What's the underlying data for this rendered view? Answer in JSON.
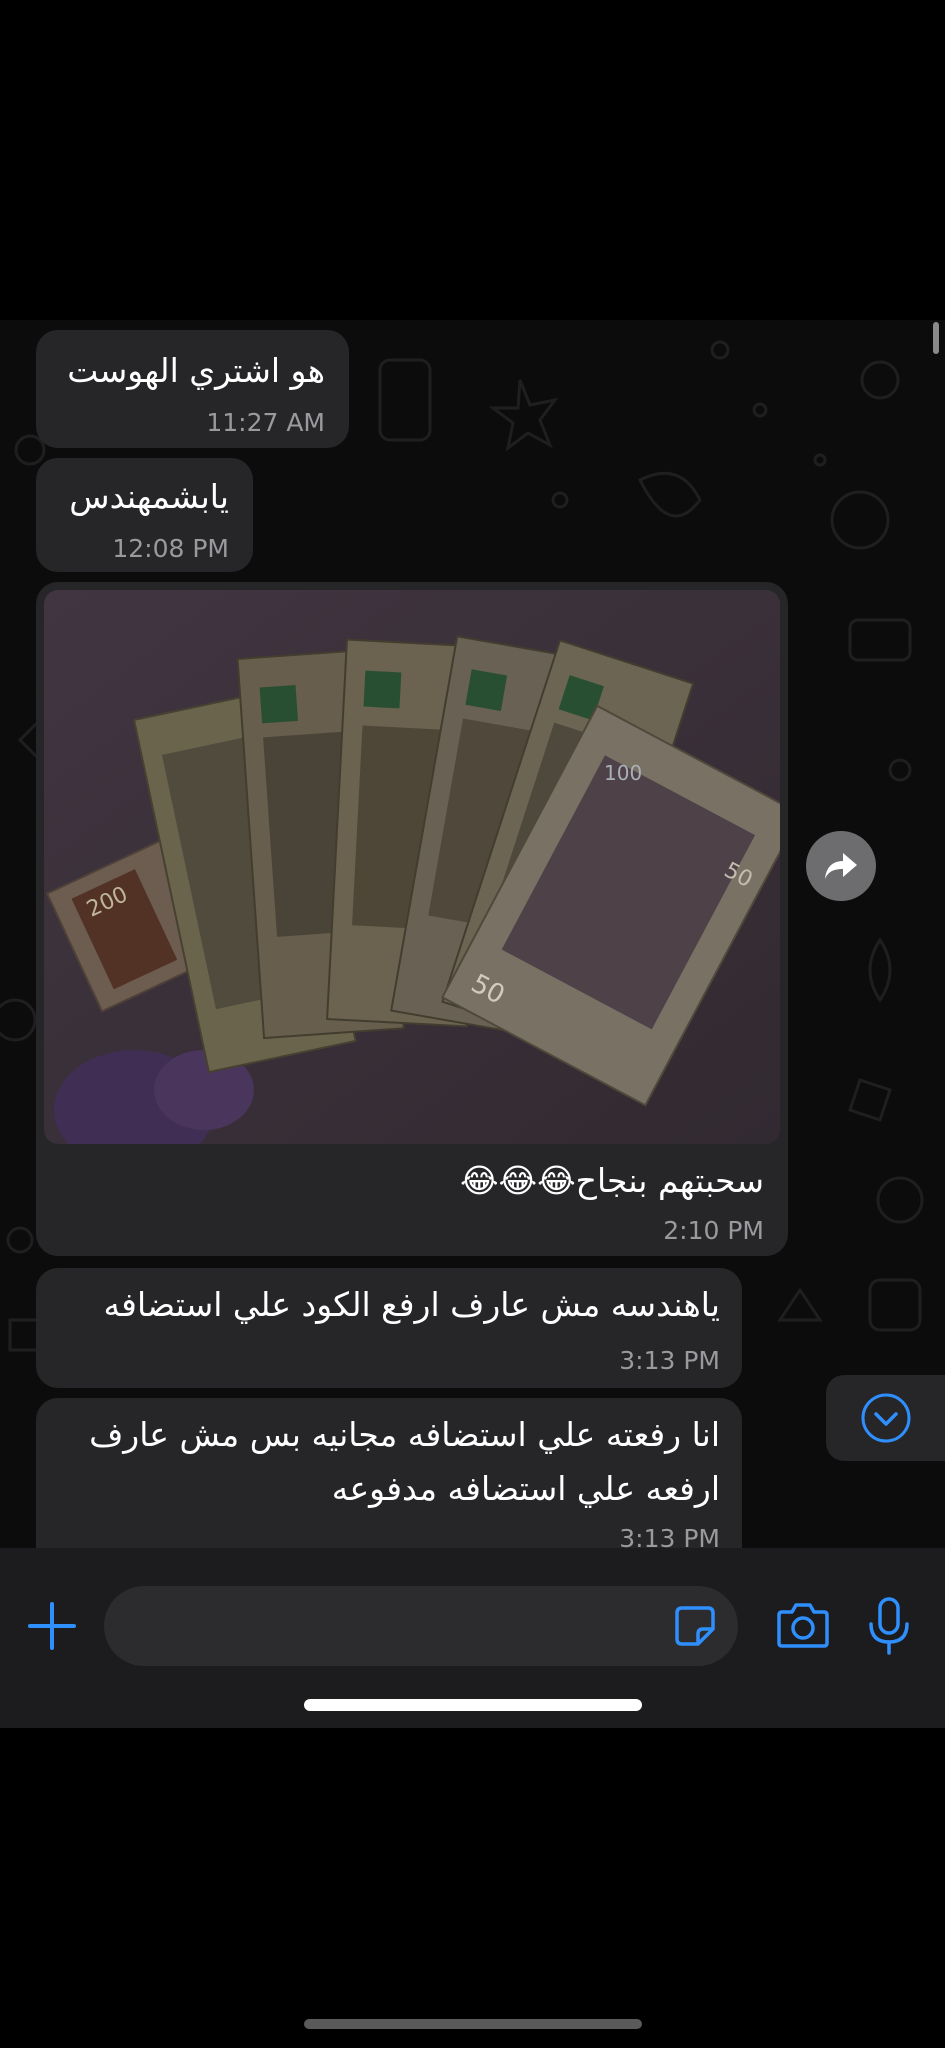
{
  "messages": [
    {
      "text": "هو اشتري الهوست",
      "time": "11:27 AM"
    },
    {
      "text": "يابشمهندس",
      "time": "12:08 PM"
    },
    {
      "text": "سحبتهم بنجاح😂😂😂",
      "time": "2:10 PM",
      "has_photo": true
    },
    {
      "text": "ياهندسه مش عارف ارفع الكود علي استضافه",
      "time": "3:13 PM"
    },
    {
      "text": "انا رفعته علي استضافه مجانيه بس مش عارف ارفعه علي استضافه مدفوعه",
      "time": "3:13 PM"
    }
  ],
  "photo_note_labels": [
    "200",
    "50",
    "50",
    "100"
  ],
  "colors": {
    "bubble": "#262628",
    "accent": "#2f8ffd",
    "time": "#9a9a9e",
    "background": "#0c0c0c"
  },
  "icons": {
    "forward": "forward-arrow-icon",
    "scroll_down": "chevron-down-circle-icon",
    "attach": "plus-icon",
    "sticker": "sticker-icon",
    "camera": "camera-icon",
    "mic": "microphone-icon"
  }
}
